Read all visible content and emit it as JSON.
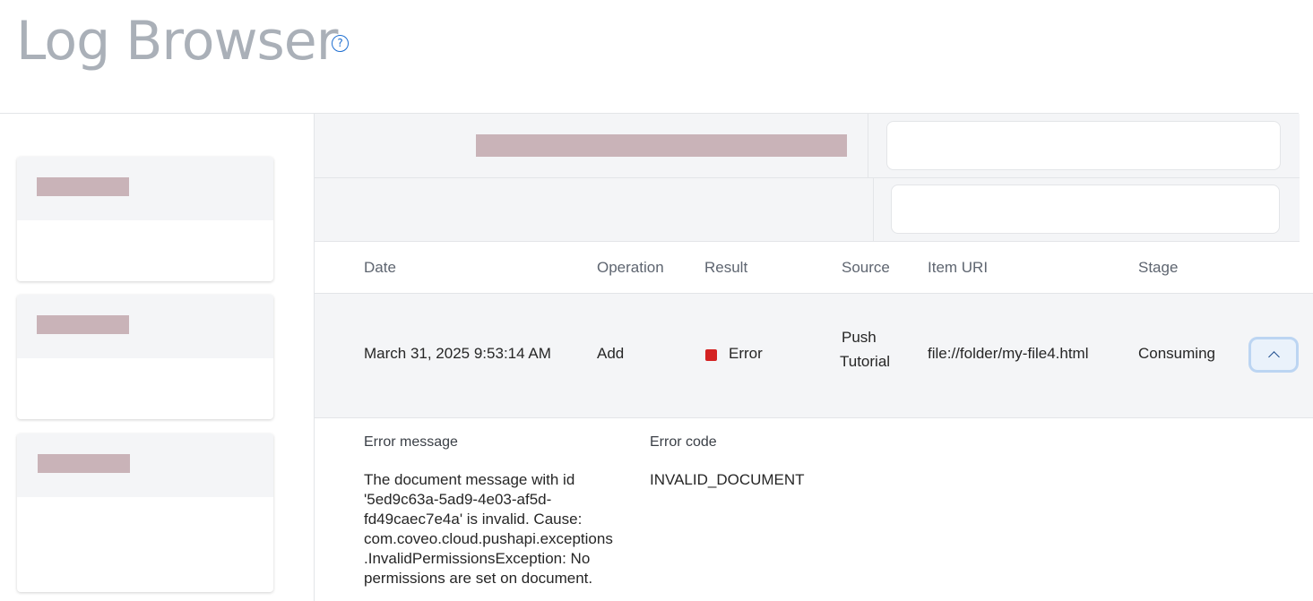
{
  "page": {
    "title": "Log Browser",
    "help_icon": "question-circle-icon"
  },
  "table": {
    "headers": {
      "date": "Date",
      "operation": "Operation",
      "result": "Result",
      "source": "Source",
      "item_uri": "Item URI",
      "stage": "Stage"
    },
    "row": {
      "date": "March 31, 2025 9:53:14 AM",
      "operation": "Add",
      "result": "Error",
      "source_line1": "Push",
      "source_line2": "Tutorial",
      "item_uri": "file://folder/my-file4.html",
      "stage": "Consuming",
      "collapse_icon": "chevron-up-icon"
    }
  },
  "details": {
    "error_message_label": "Error message",
    "error_code_label": "Error code",
    "error_message_lines": [
      "The document message with id",
      "'5ed9c63a-5ad9-4e03-af5d-",
      "fd49caec7e4a' is invalid. Cause:",
      "com.coveo.cloud.pushapi.exceptions",
      ".InvalidPermissionsException: No",
      "permissions are set on document."
    ],
    "error_code": "INVALID_DOCUMENT"
  },
  "colors": {
    "error": "#d42222",
    "accent": "#1f6fd1",
    "title": "#aab0b8"
  }
}
